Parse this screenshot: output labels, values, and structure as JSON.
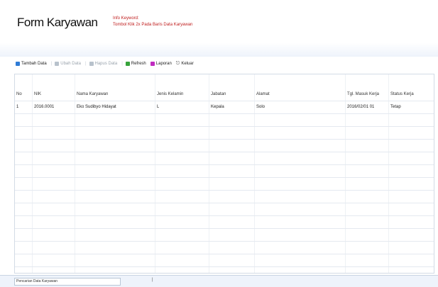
{
  "title": "Form Karyawan",
  "info": {
    "line1": "Info Keyword:",
    "line2": "Tombol Klik 2x Pada Baris Data Karyawan"
  },
  "toolbar": {
    "buttons": [
      {
        "label": "Tambah Data",
        "icon": "add-icon",
        "state": "enabled"
      },
      {
        "label": "Ubah Data",
        "icon": "edit-icon",
        "state": "disabled"
      },
      {
        "label": "Hapus Data",
        "icon": "delete-icon",
        "state": "disabled"
      },
      {
        "label": "Refresh",
        "icon": "refresh-icon",
        "state": "enabled"
      },
      {
        "label": "Laporan",
        "icon": "report-icon",
        "state": "enabled"
      },
      {
        "label": "Keluar",
        "icon": "exit-icon",
        "state": "enabled"
      }
    ]
  },
  "table": {
    "columns": [
      "No",
      "NIK",
      "Nama Karyawan",
      "Jenis Kelamin",
      "Jabatan",
      "Alamat",
      "Tgl. Masuk Kerja",
      "Status Kerja"
    ],
    "rows": [
      [
        "1",
        "2016.0001",
        "Eko Sudibyo Hidayat",
        "L",
        "Kepala",
        "Solo",
        "2016/02/01 01",
        "Tetap"
      ]
    ],
    "empty_rows": 13
  },
  "statusbar": {
    "field_text": "Pencarian Data Karyawan",
    "mark": "|"
  }
}
